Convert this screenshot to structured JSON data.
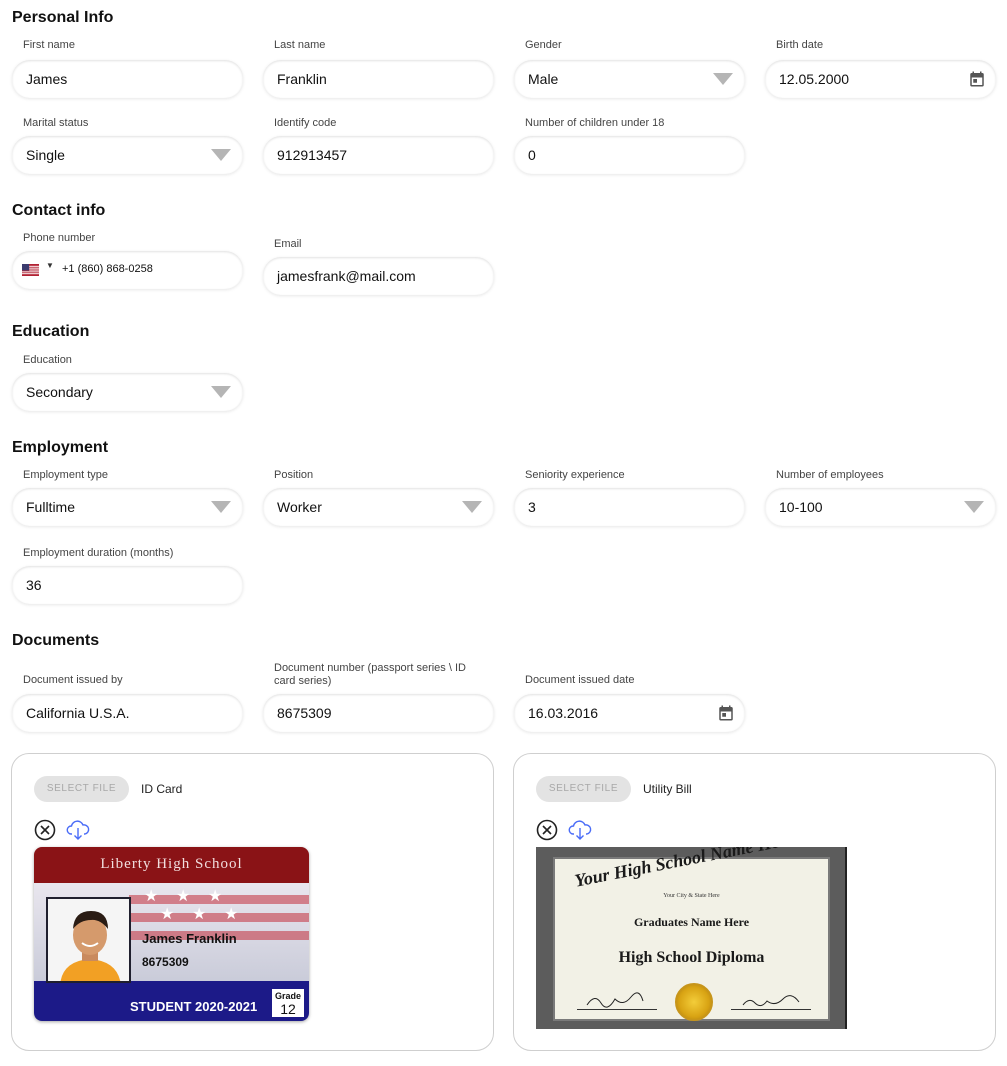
{
  "sections": {
    "personal": "Personal Info",
    "contact": "Contact info",
    "education": "Education",
    "employment": "Employment",
    "documents": "Documents"
  },
  "personal": {
    "first_name": {
      "label": "First name",
      "value": "James"
    },
    "last_name": {
      "label": "Last name",
      "value": "Franklin"
    },
    "gender": {
      "label": "Gender",
      "value": "Male"
    },
    "birth_date": {
      "label": "Birth date",
      "value": "12.05.2000"
    },
    "marital_status": {
      "label": "Marital status",
      "value": "Single"
    },
    "identify_code": {
      "label": "Identify code",
      "value": "912913457"
    },
    "children": {
      "label": "Number of children under 18",
      "value": "0"
    }
  },
  "contact": {
    "phone": {
      "label": "Phone number",
      "value": "+1 (860) 868-0258",
      "country_flag": "us-flag-icon"
    },
    "email": {
      "label": "Email",
      "value": "jamesfrank@mail.com"
    }
  },
  "education": {
    "education": {
      "label": "Education",
      "value": "Secondary"
    }
  },
  "employment": {
    "type": {
      "label": "Employment type",
      "value": "Fulltime"
    },
    "position": {
      "label": "Position",
      "value": "Worker"
    },
    "seniority": {
      "label": "Seniority experience",
      "value": "3"
    },
    "employees": {
      "label": "Number of employees",
      "value": "10-100"
    },
    "duration": {
      "label": "Employment duration (months)",
      "value": "36"
    }
  },
  "documents": {
    "issued_by": {
      "label": "Document issued by",
      "value": "California U.S.A."
    },
    "number": {
      "label": "Document number (passport series \\ ID card series)",
      "value": "8675309"
    },
    "issued_date": {
      "label": "Document issued date",
      "value": "16.03.2016"
    }
  },
  "uploads": [
    {
      "button": "SELECT FILE",
      "label": "ID Card",
      "image": {
        "school": "Liberty High School",
        "name": "James Franklin",
        "number": "8675309",
        "student": "STUDENT 2020-2021",
        "grade_label": "Grade",
        "grade": "12"
      }
    },
    {
      "button": "SELECT FILE",
      "label": "Utility Bill",
      "image": {
        "title": "Your High School Name Here",
        "city": "Your City & State Here",
        "graduate": "Graduates Name Here",
        "diploma": "High School Diploma"
      }
    }
  ],
  "colors": {
    "accent": "#4a6cf7",
    "id_header": "#8a1316",
    "id_footer": "#1c1a88"
  }
}
